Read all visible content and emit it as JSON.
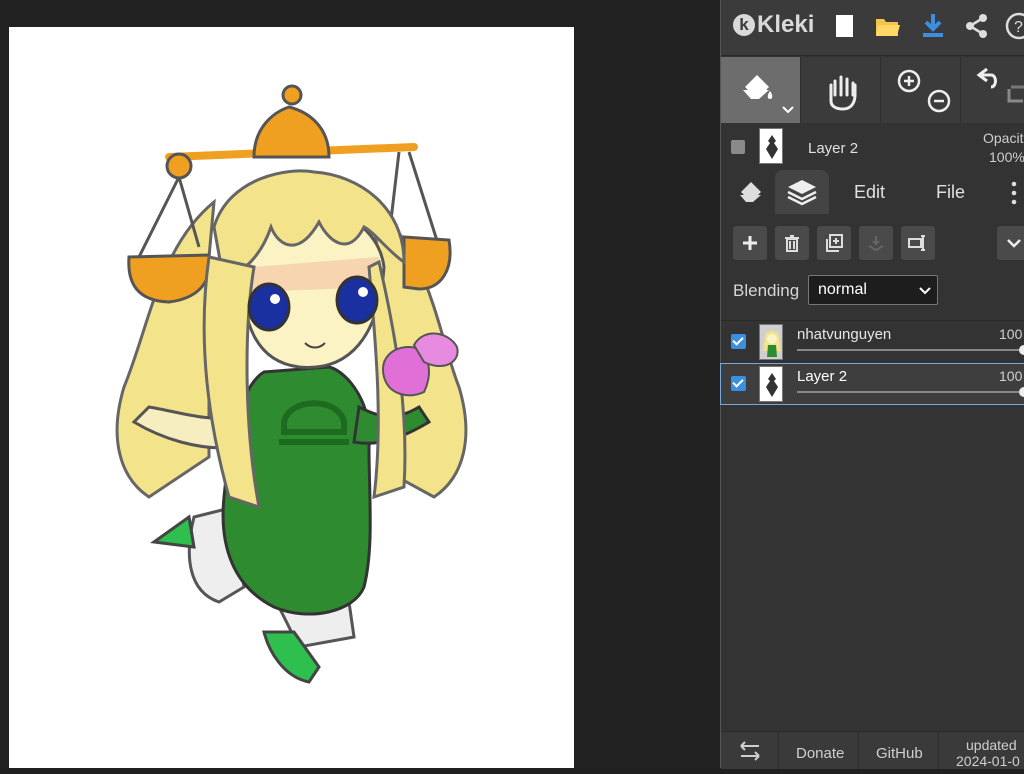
{
  "app": {
    "name": "Kleki",
    "accent": "#3b8ee0"
  },
  "header_icons": [
    "new-file-icon",
    "folder-open-icon",
    "download-icon",
    "share-icon",
    "help-icon"
  ],
  "tools": {
    "items": [
      "fill-bucket-icon",
      "hand-pan-icon",
      "zoom-in-icon",
      "zoom-out-icon",
      "undo-icon",
      "redo-icon"
    ],
    "active": "fill-bucket-icon"
  },
  "current_layer": {
    "name": "Layer 2",
    "opacity_label": "Opacit",
    "opacity_value": "100%"
  },
  "tabs": {
    "brush_icon": "brush-tab-icon",
    "layers_icon": "layers-tab-icon",
    "edit": "Edit",
    "file": "File",
    "active": "layers"
  },
  "layer_actions": [
    "add-layer-icon",
    "delete-layer-icon",
    "duplicate-layer-icon",
    "merge-down-icon",
    "rename-layer-icon",
    "collapse-icon"
  ],
  "blending": {
    "label": "Blending",
    "value": "normal"
  },
  "layers": [
    {
      "name": "nhatvunguyen",
      "opacity": "100",
      "opacity_value": 1.0,
      "visible": true,
      "selected": false
    },
    {
      "name": "Layer 2",
      "opacity": "100",
      "opacity_value": 1.0,
      "visible": true,
      "selected": true
    }
  ],
  "footer": {
    "swap_icon": "swap-arrows-icon",
    "donate": "Donate",
    "github": "GitHub",
    "updated_label": "updated",
    "updated_date": "2024-01-0"
  }
}
